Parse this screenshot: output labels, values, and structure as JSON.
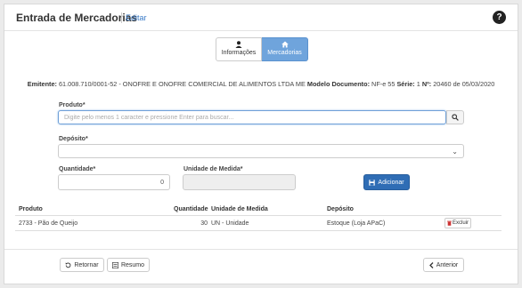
{
  "header": {
    "title": "Entrada de Mercadorias",
    "edit_link": "Editar",
    "help_icon": "question-circle-icon"
  },
  "tabs": [
    {
      "label": "Informações",
      "icon": "user-icon",
      "active": false
    },
    {
      "label": "Mercadorias",
      "icon": "home-icon",
      "active": true
    }
  ],
  "emitente": {
    "emitente_label": "Emitente:",
    "emitente_value": "61.008.710/0001-52 - ONOFRE E ONOFRE COMERCIAL DE ALIMENTOS LTDA ME",
    "modelo_label": "Modelo Documento:",
    "modelo_value": "NF-e 55",
    "serie_label": "Série:",
    "serie_value": "1",
    "numero_label": "Nº:",
    "numero_value": "20460",
    "data_connector": "de",
    "data_value": "05/03/2020"
  },
  "form": {
    "produto_label": "Produto*",
    "produto_placeholder": "Digite pelo menos 1 caracter e pressione Enter para buscar...",
    "deposito_label": "Depósito*",
    "deposito_value": "",
    "quantidade_label": "Quantidade*",
    "quantidade_value": "0",
    "unidade_label": "Unidade de Medida*",
    "unidade_value": "",
    "add_label": "Adicionar"
  },
  "table": {
    "headers": {
      "produto": "Produto",
      "quantidade": "Quantidade",
      "unidade": "Unidade de Medida",
      "deposito": "Depósito"
    },
    "rows": [
      {
        "produto": "2733 - Pão de Queijo",
        "quantidade": "30",
        "unidade": "UN - Unidade",
        "deposito": "Estoque (Loja APaC)",
        "delete_label": "Excluir"
      }
    ]
  },
  "footer": {
    "retornar_label": "Retornar",
    "resumo_label": "Resumo",
    "anterior_label": "Anterior"
  },
  "colors": {
    "accent": "#6fa4dc",
    "primary_button": "#2f6db5",
    "link": "#3a7bc8"
  }
}
